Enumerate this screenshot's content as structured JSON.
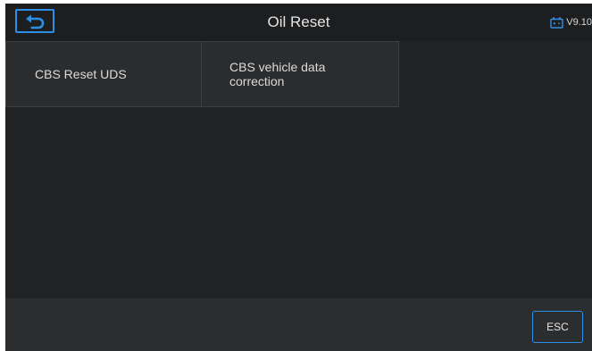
{
  "header": {
    "title": "Oil Reset",
    "version": "V9.10",
    "back_icon": "back-arrow-icon",
    "battery_icon": "battery-icon"
  },
  "menu": {
    "items": [
      {
        "label": "CBS Reset UDS"
      },
      {
        "label": "CBS vehicle data correction"
      }
    ]
  },
  "footer": {
    "esc_label": "ESC"
  },
  "colors": {
    "accent": "#2e8fe6",
    "background": "#222324",
    "header_bg": "#1d1e20",
    "cell_bg": "#2b2c2e",
    "footer_bg": "#2c2d2f"
  }
}
